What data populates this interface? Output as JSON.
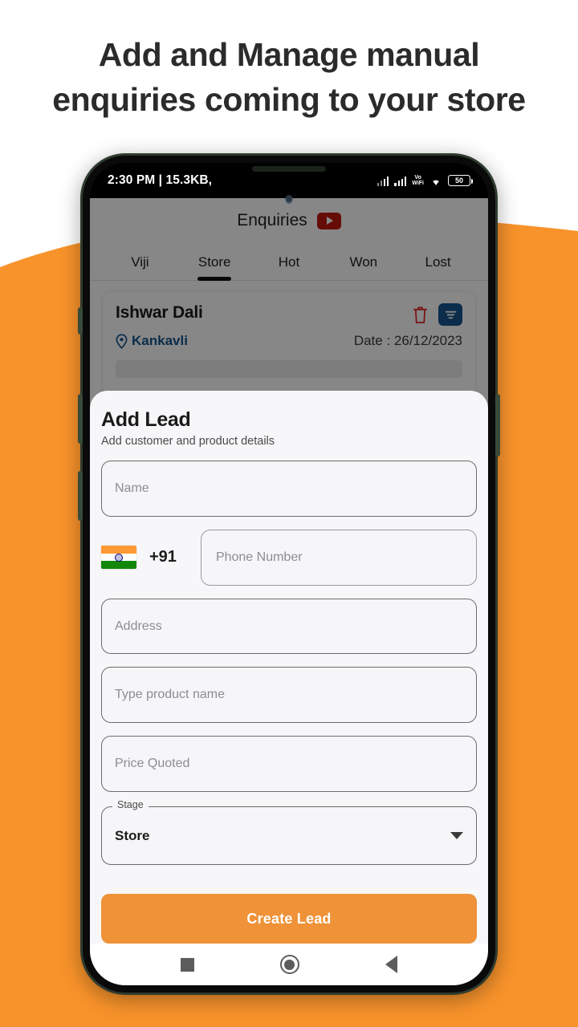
{
  "page": {
    "headline_line1": "Add and Manage manual",
    "headline_line2": "enquiries coming to your store",
    "background_color": "#F8932B",
    "accent_color": "#EF9238"
  },
  "status_bar": {
    "time_and_data": "2:30 PM | 15.3KB,",
    "vo_wifi": "Vo",
    "vo_wifi_2": "WiFi",
    "battery_level": "50"
  },
  "app": {
    "header": {
      "title": "Enquiries",
      "youtube_icon": "youtube-icon"
    },
    "tabs": [
      {
        "label": "Viji",
        "active": false
      },
      {
        "label": "Store",
        "active": true
      },
      {
        "label": "Hot",
        "active": false
      },
      {
        "label": "Won",
        "active": false
      },
      {
        "label": "Lost",
        "active": false
      }
    ],
    "lead_card": {
      "name": "Ishwar Dali",
      "location": "Kankavli",
      "date": "Date : 26/12/2023",
      "delete_icon": "trash-icon",
      "filter_icon": "filter-icon",
      "location_icon": "map-pin-icon"
    }
  },
  "sheet": {
    "title": "Add Lead",
    "subtitle": "Add customer and product details",
    "fields": {
      "name_placeholder": "Name",
      "country_code": "+91",
      "country_flag": "india-flag-icon",
      "phone_placeholder": "Phone Number",
      "address_placeholder": "Address",
      "product_placeholder": "Type product name",
      "price_placeholder": "Price Quoted"
    },
    "stage": {
      "label": "Stage",
      "value": "Store",
      "caret_icon": "chevron-down-icon"
    },
    "submit_label": "Create Lead"
  },
  "nav_bar": {
    "recents_icon": "square-recents-icon",
    "home_icon": "circle-home-icon",
    "back_icon": "triangle-back-icon"
  }
}
